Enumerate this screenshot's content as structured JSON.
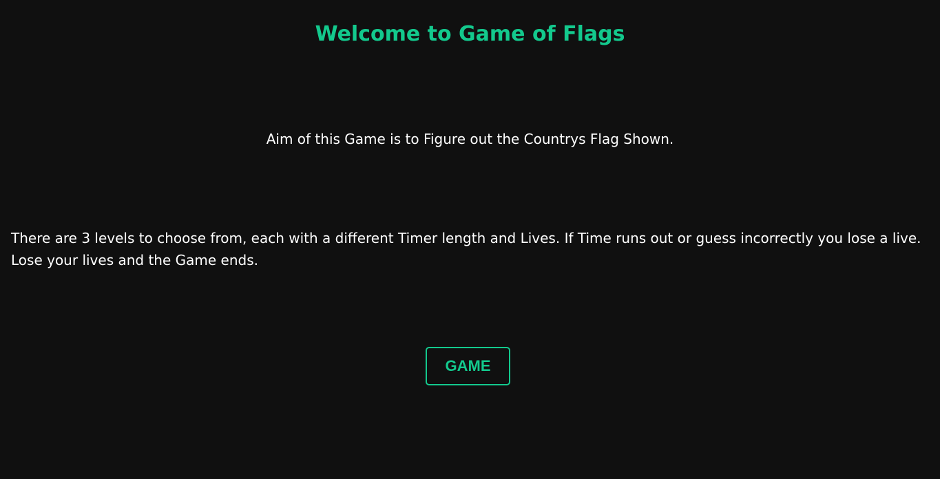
{
  "header": {
    "title": "Welcome to Game of Flags"
  },
  "intro": {
    "aim_text": "Aim of this Game is to Figure out the Countrys Flag Shown.",
    "levels_line1": "There are 3 levels to choose from, each with a different Timer length and Lives. If Time runs out or guess incorrectly you lose a live.",
    "levels_line2": "Lose your lives and the Game ends."
  },
  "actions": {
    "game_label": "GAME"
  },
  "theme": {
    "background": "#101010",
    "accent": "#13c98d",
    "text": "#ffffff"
  }
}
